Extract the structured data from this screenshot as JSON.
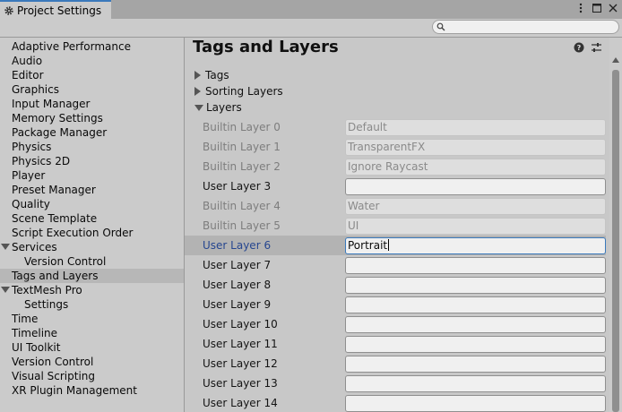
{
  "window": {
    "tab_title": "Project Settings",
    "icons": [
      "more-vert-icon",
      "maximize-icon",
      "close-icon"
    ]
  },
  "search": {
    "placeholder": "",
    "value": ""
  },
  "sidebar": {
    "items": [
      {
        "label": "Adaptive Performance"
      },
      {
        "label": "Audio"
      },
      {
        "label": "Editor"
      },
      {
        "label": "Graphics"
      },
      {
        "label": "Input Manager"
      },
      {
        "label": "Memory Settings"
      },
      {
        "label": "Package Manager"
      },
      {
        "label": "Physics"
      },
      {
        "label": "Physics 2D"
      },
      {
        "label": "Player"
      },
      {
        "label": "Preset Manager"
      },
      {
        "label": "Quality"
      },
      {
        "label": "Scene Template"
      },
      {
        "label": "Script Execution Order"
      },
      {
        "label": "Services",
        "expanded": true
      },
      {
        "label": "Version Control",
        "child": true
      },
      {
        "label": "Tags and Layers",
        "selected": true
      },
      {
        "label": "TextMesh Pro",
        "expanded": true
      },
      {
        "label": "Settings",
        "child": true
      },
      {
        "label": "Time"
      },
      {
        "label": "Timeline"
      },
      {
        "label": "UI Toolkit"
      },
      {
        "label": "Version Control"
      },
      {
        "label": "Visual Scripting"
      },
      {
        "label": "XR Plugin Management"
      }
    ]
  },
  "main": {
    "title": "Tags and Layers",
    "header_icons": [
      "help-icon",
      "preset-icon",
      "more-vert-icon"
    ],
    "sections": {
      "tags": "Tags",
      "sorting_layers": "Sorting Layers",
      "layers": "Layers"
    },
    "layers": [
      {
        "label": "Builtin Layer 0",
        "value": "Default",
        "builtin": true
      },
      {
        "label": "Builtin Layer 1",
        "value": "TransparentFX",
        "builtin": true
      },
      {
        "label": "Builtin Layer 2",
        "value": "Ignore Raycast",
        "builtin": true
      },
      {
        "label": "User Layer 3",
        "value": "",
        "builtin": false
      },
      {
        "label": "Builtin Layer 4",
        "value": "Water",
        "builtin": true
      },
      {
        "label": "Builtin Layer 5",
        "value": "UI",
        "builtin": true
      },
      {
        "label": "User Layer 6",
        "value": "Portrait",
        "builtin": false,
        "selected": true
      },
      {
        "label": "User Layer 7",
        "value": "",
        "builtin": false
      },
      {
        "label": "User Layer 8",
        "value": "",
        "builtin": false
      },
      {
        "label": "User Layer 9",
        "value": "",
        "builtin": false
      },
      {
        "label": "User Layer 10",
        "value": "",
        "builtin": false
      },
      {
        "label": "User Layer 11",
        "value": "",
        "builtin": false
      },
      {
        "label": "User Layer 12",
        "value": "",
        "builtin": false
      },
      {
        "label": "User Layer 13",
        "value": "",
        "builtin": false
      },
      {
        "label": "User Layer 14",
        "value": "",
        "builtin": false
      }
    ]
  },
  "colors": {
    "accent": "#3a79bb",
    "selected_label": "#26468f",
    "panel_bg": "#c8c8c8"
  }
}
